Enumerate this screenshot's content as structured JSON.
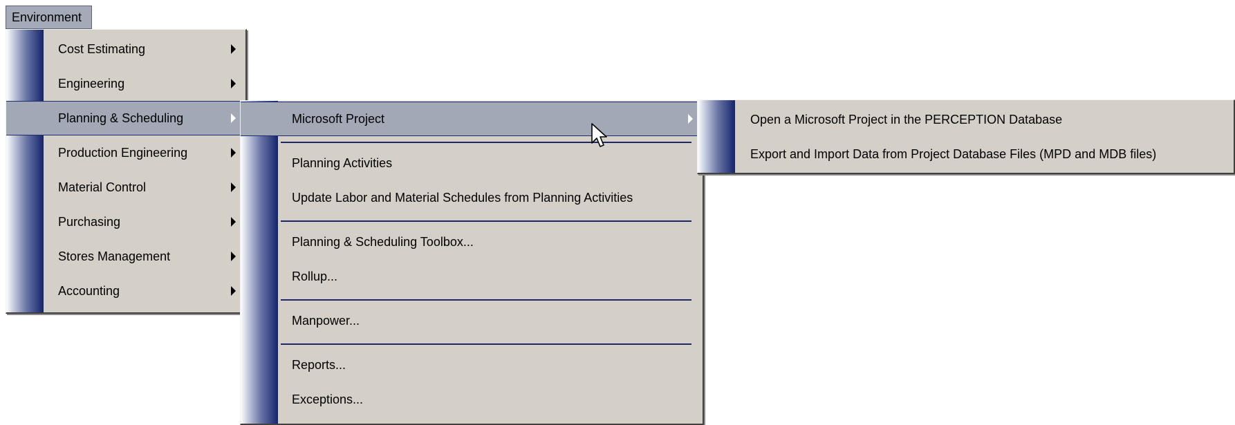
{
  "menubar": {
    "environment_label": "Environment"
  },
  "menu_environment": {
    "items": [
      {
        "label": "Cost Estimating"
      },
      {
        "label": "Engineering"
      },
      {
        "label": "Planning & Scheduling"
      },
      {
        "label": "Production Engineering"
      },
      {
        "label": "Material Control"
      },
      {
        "label": "Purchasing"
      },
      {
        "label": "Stores Management"
      },
      {
        "label": "Accounting"
      }
    ]
  },
  "menu_planning": {
    "items": [
      {
        "label": "Microsoft Project"
      },
      {
        "label": "Planning Activities"
      },
      {
        "label": "Update Labor and Material Schedules from Planning Activities"
      },
      {
        "label": "Planning & Scheduling Toolbox..."
      },
      {
        "label": "Rollup..."
      },
      {
        "label": "Manpower..."
      },
      {
        "label": "Reports..."
      },
      {
        "label": "Exceptions..."
      }
    ]
  },
  "menu_msproject": {
    "items": [
      {
        "label": "Open a Microsoft Project in the PERCEPTION Database"
      },
      {
        "label": "Export and Import Data from Project Database Files (MPD and MDB files)"
      }
    ]
  },
  "colors": {
    "menu_background": "#d4d0c8",
    "highlight": "#a3a8b6",
    "stripe_dark": "#14246c",
    "separator": "#1c2668"
  },
  "icons": {
    "submenu_arrow": "triangle-right",
    "pointer": "mouse-cursor-arrow"
  }
}
